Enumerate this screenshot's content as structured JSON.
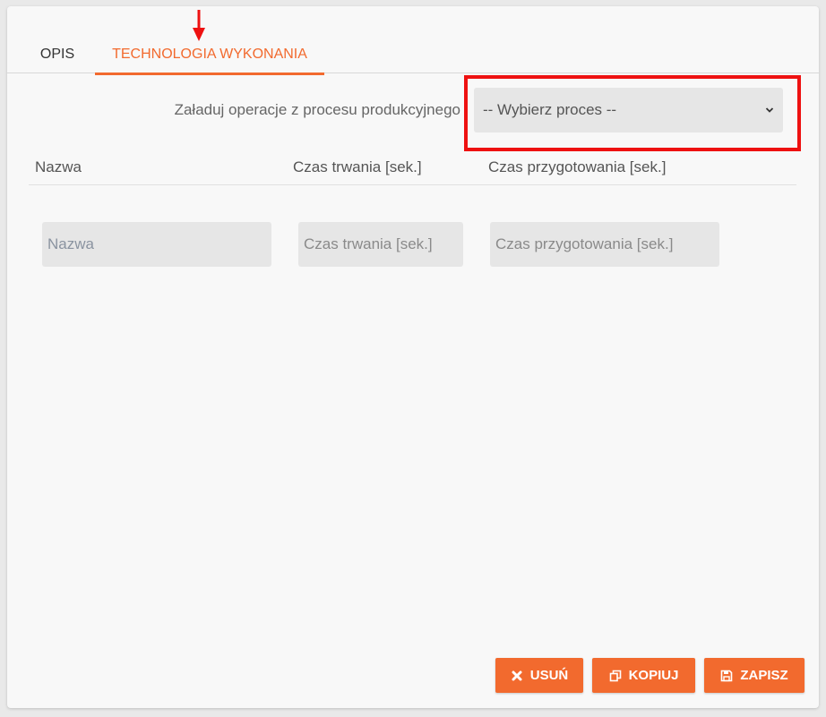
{
  "tabs": [
    {
      "label": "OPIS",
      "active": false
    },
    {
      "label": "TECHNOLOGIA WYKONANIA",
      "active": true
    }
  ],
  "load_process": {
    "label": "Załaduj operacje z procesu produkcyjnego",
    "select_value": "-- Wybierz proces --"
  },
  "table": {
    "headers": [
      "Nazwa",
      "Czas trwania [sek.]",
      "Czas przygotowania [sek.]"
    ],
    "new_row": {
      "name_placeholder": "Nazwa",
      "duration_placeholder": "Czas trwania [sek.]",
      "prep_placeholder": "Czas przygotowania [sek.]"
    }
  },
  "actions": {
    "delete_label": "USUŃ",
    "copy_label": "KOPIUJ",
    "save_label": "ZAPISZ"
  },
  "icons": {
    "delete": "close-x-icon",
    "copy": "copy-icon",
    "save": "floppy-disk-icon",
    "select": "chevron-down-icon",
    "annotation": "red-arrow-down-icon"
  },
  "colors": {
    "accent": "#f26a2e",
    "annotation": "#ee1111"
  }
}
